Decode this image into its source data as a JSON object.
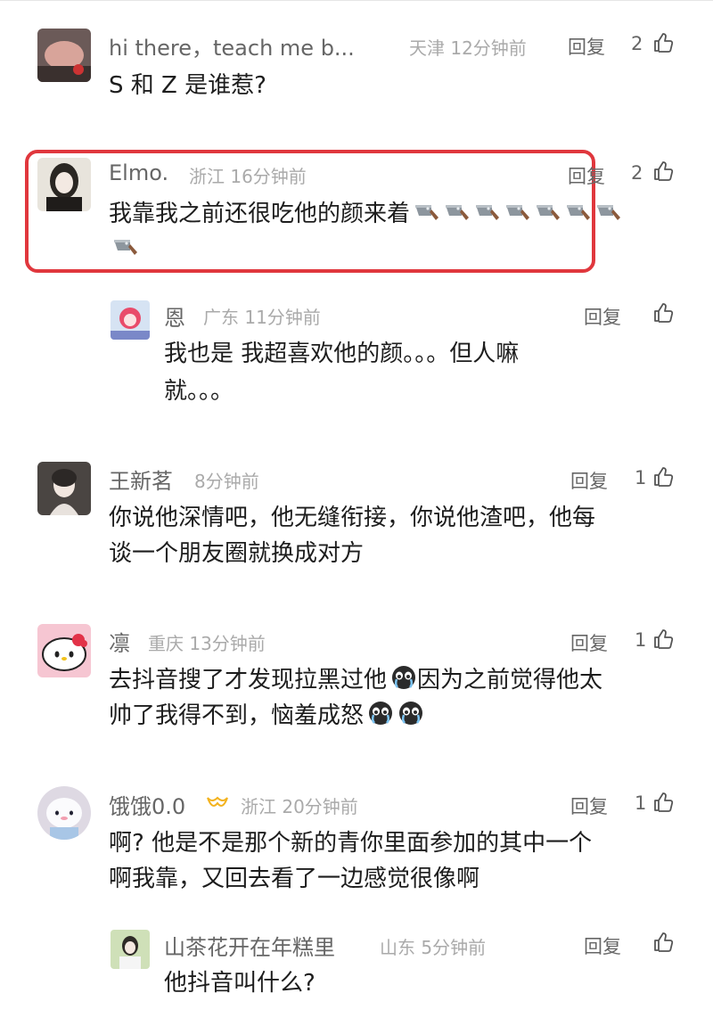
{
  "comments": [
    {
      "username": "hi there，teach me b...",
      "location": "天津",
      "time": "12分钟前",
      "reply_label": "回复",
      "likes": "2",
      "text_lines": [
        "S 和 Z 是谁惹?"
      ]
    },
    {
      "username": "Elmo.",
      "location": "浙江",
      "time": "16分钟前",
      "reply_label": "回复",
      "likes": "2",
      "text_lines": [
        "我靠我之前还很吃他的颜来着"
      ],
      "emoji": "cleaver-knife",
      "emoji_count": 8,
      "highlighted": true,
      "highlight_color": "#e0373d"
    },
    {
      "username": "恩",
      "location": "广东",
      "time": "11分钟前",
      "reply_label": "回复",
      "likes": "",
      "text_lines": [
        "我也是 我超喜欢他的颜。。。但人嘛",
        "就。。。"
      ],
      "nested": true
    },
    {
      "username": "王新茗",
      "location": "",
      "time": "8分钟前",
      "reply_label": "回复",
      "likes": "1",
      "text_lines": [
        "你说他深情吧，他无缝衔接，你说他渣吧，他每",
        "谈一个朋友圈就换成对方"
      ]
    },
    {
      "username": "凛",
      "location": "重庆",
      "time": "13分钟前",
      "reply_label": "回复",
      "likes": "1",
      "text_lines": [
        "去抖音搜了才发现拉黑过他",
        "因为之前觉得他太",
        "帅了我得不到，恼羞成怒"
      ],
      "emoji": "crying-face"
    },
    {
      "username": "饿饿0.0",
      "location": "浙江",
      "time": "20分钟前",
      "reply_label": "回复",
      "likes": "1",
      "text_lines": [
        "啊? 他是不是那个新的青你里面参加的其中一个",
        "啊我靠，又回去看了一边感觉很像啊"
      ],
      "badge_icon": "crown-icon"
    },
    {
      "username": "山茶花开在年糕里",
      "location": "山东",
      "time": "5分钟前",
      "reply_label": "回复",
      "likes": "",
      "text_lines": [
        "他抖音叫什么?"
      ],
      "nested": true
    }
  ],
  "colors": {
    "username": "#666666",
    "meta": "#aaaaaa",
    "text": "#1d1d1d",
    "highlight": "#e0373d"
  }
}
